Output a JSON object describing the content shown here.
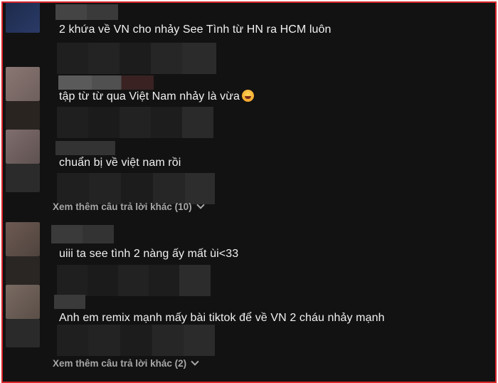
{
  "comments": [
    {
      "text": "2 khứa về VN cho nhảy See Tình từ HN ra HCM luôn",
      "emoji": ""
    },
    {
      "text": "tập từ từ qua Việt Nam nhảy là vừa",
      "emoji": "laughing-emoji"
    },
    {
      "text": "chuẩn bị về việt nam rồi",
      "emoji": ""
    },
    {
      "text": "uiii ta see tình 2 nàng ấy mất ùi<33",
      "emoji": ""
    },
    {
      "text": "Anh em remix mạnh mấy bài tiktok để về VN 2 cháu nhảy mạnh",
      "emoji": ""
    }
  ],
  "view_more": [
    {
      "label": "Xem thêm câu trả lời khác (10)",
      "icon": "chevron-down-icon"
    },
    {
      "label": "Xem thêm câu trả lời khác (2)",
      "icon": "chevron-down-icon"
    }
  ],
  "colors": {
    "background": "#121212",
    "text": "#f1f1f1",
    "muted": "#a8a8a8",
    "border": "#d9262c"
  }
}
